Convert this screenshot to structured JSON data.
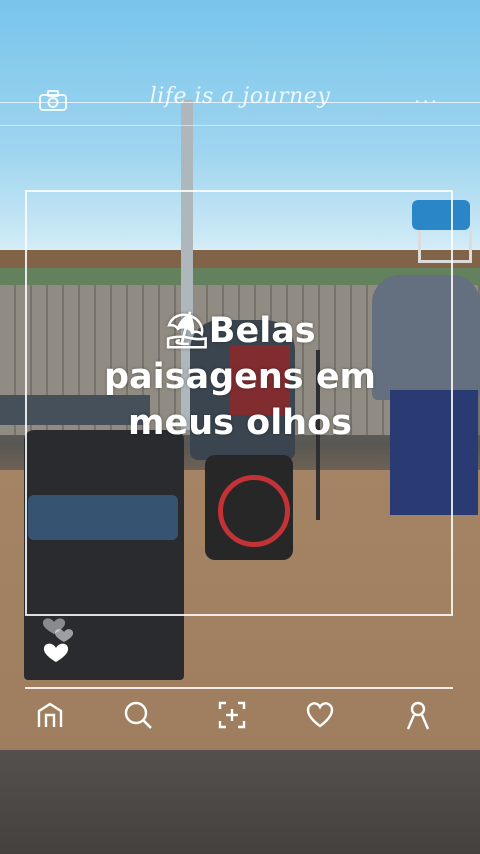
{
  "header": {
    "camera_icon": "camera-icon",
    "title": "life is a journey",
    "more_label": "..."
  },
  "caption": {
    "emoji": "⛱",
    "line1": "Belas",
    "line2": "paisagens em",
    "line3": "meus olhos"
  },
  "reactions": {
    "icon": "hearts-icon"
  },
  "nav": {
    "items": [
      {
        "icon": "home-icon"
      },
      {
        "icon": "search-icon"
      },
      {
        "icon": "add-icon"
      },
      {
        "icon": "heart-icon"
      },
      {
        "icon": "profile-icon"
      }
    ]
  },
  "colors": {
    "overlay_line": "#ffffff",
    "text": "#ffffff"
  }
}
